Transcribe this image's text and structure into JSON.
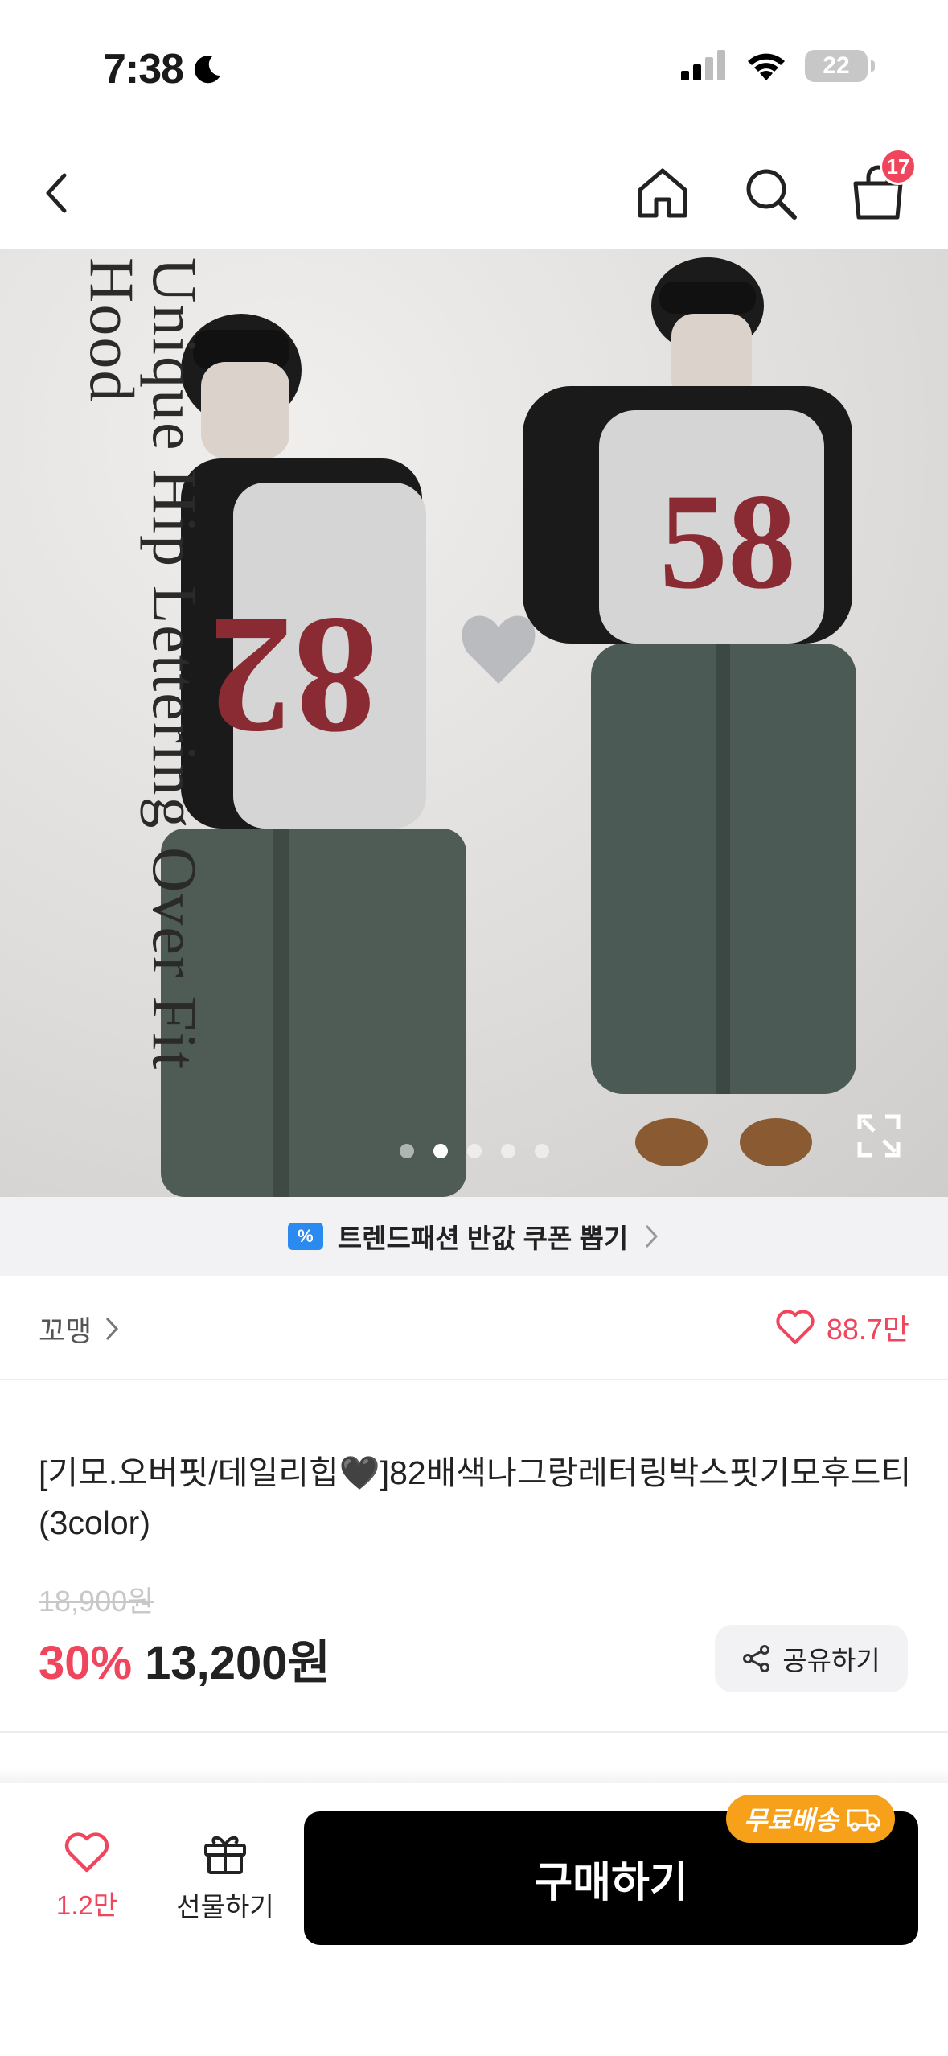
{
  "status_bar": {
    "time": "7:38",
    "battery": "22"
  },
  "nav": {
    "cart_count": "17"
  },
  "hero": {
    "image_title": "Unique Hip Lettering Over Fit Hood",
    "slide_count": 5,
    "active_slide": 2
  },
  "coupon": {
    "icon_text": "%",
    "text": "트렌드패션 반값 쿠폰 뽑기"
  },
  "shop": {
    "name": "꼬맹",
    "likes": "88.7만"
  },
  "product": {
    "title": "[기모.오버핏/데일리힙🖤]82배색나그랑레터링박스핏기모후드티(3color)",
    "original_price": "18,900원",
    "discount": "30%",
    "sale_price": "13,200원",
    "share_label": "공유하기"
  },
  "bottom": {
    "wish_count": "1.2만",
    "gift_label": "선물하기",
    "buy_label": "구매하기",
    "free_shipping_label": "무료배송"
  },
  "colors": {
    "accent": "#f0465d",
    "buy_button": "#000000",
    "free_shipping": "#f7a11a",
    "coupon_icon": "#2a8af0"
  }
}
